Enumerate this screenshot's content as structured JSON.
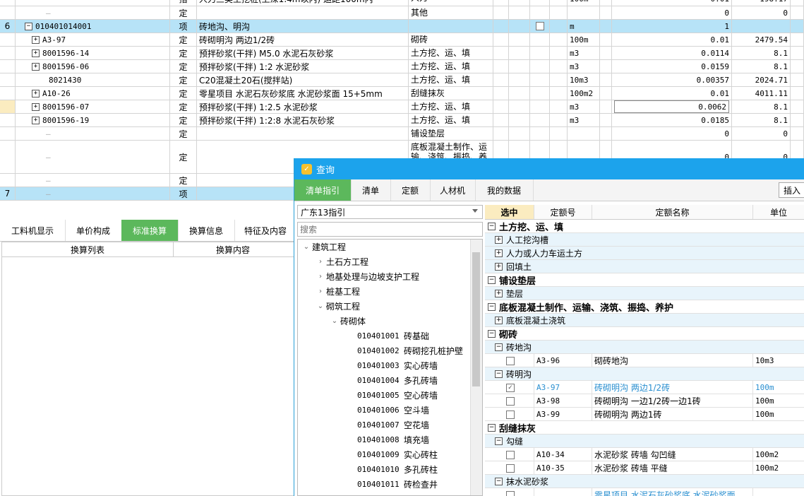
{
  "main_grid": {
    "rows": [
      {
        "idx": "",
        "code": "",
        "type": "指",
        "name": "人力三类土挖桩(上深1.4m以内) 运距100m内",
        "cat": "人力",
        "chk": false,
        "unit": "100m",
        "qty": "0.01",
        "price": "198.17"
      },
      {
        "idx": "",
        "code": "",
        "type": "定",
        "name": "",
        "cat": "其他",
        "chk": false,
        "unit": "",
        "qty": "0",
        "price": "0"
      },
      {
        "idx": "6",
        "code": "010401014001",
        "type": "项",
        "name": "砖地沟、明沟",
        "cat": "",
        "chk": true,
        "unit": "m",
        "qty": "1",
        "price": ""
      },
      {
        "idx": "",
        "code": "A3-97",
        "type": "定",
        "name": "砖砌明沟 两边1/2砖",
        "cat": "砌砖",
        "chk": false,
        "unit": "100m",
        "qty": "0.01",
        "price": "2479.54"
      },
      {
        "idx": "",
        "code": "8001596-14",
        "type": "定",
        "name": "预拌砂浆(干拌) M5.0 水泥石灰砂浆",
        "cat": "土方挖、运、填",
        "chk": false,
        "unit": "m3",
        "qty": "0.0114",
        "price": "8.1"
      },
      {
        "idx": "",
        "code": "8001596-06",
        "type": "定",
        "name": "预拌砂浆(干拌) 1:2 水泥砂浆",
        "cat": "土方挖、运、填",
        "chk": false,
        "unit": "m3",
        "qty": "0.0159",
        "price": "8.1"
      },
      {
        "idx": "",
        "code": "8021430",
        "type": "定",
        "name": "C20混凝土20石(搅拌站)",
        "cat": "土方挖、运、填",
        "chk": false,
        "unit": "10m3",
        "qty": "0.00357",
        "price": "2024.71"
      },
      {
        "idx": "",
        "code": "A10-26",
        "type": "定",
        "name": "零星项目 水泥石灰砂浆底 水泥砂浆面 15+5mm",
        "cat": "刮缝抹灰",
        "chk": false,
        "unit": "100m2",
        "qty": "0.01",
        "price": "4011.11"
      },
      {
        "idx": "",
        "code": "8001596-07",
        "type": "定",
        "name": "预拌砂浆(干拌) 1:2.5 水泥砂浆",
        "cat": "土方挖、运、填",
        "chk": false,
        "unit": "m3",
        "qty": "0.0062",
        "price": "8.1"
      },
      {
        "idx": "",
        "code": "8001596-19",
        "type": "定",
        "name": "预拌砂浆(干拌) 1:2:8 水泥石灰砂浆",
        "cat": "土方挖、运、填",
        "chk": false,
        "unit": "m3",
        "qty": "0.0185",
        "price": "8.1"
      },
      {
        "idx": "",
        "code": "",
        "type": "定",
        "name": "",
        "cat": "铺设垫层",
        "chk": false,
        "unit": "",
        "qty": "0",
        "price": "0"
      },
      {
        "idx": "",
        "code": "",
        "type": "定",
        "name": "",
        "cat": "底板混凝土制作、运输、浇筑、振捣、养",
        "chk": false,
        "unit": "",
        "qty": "0",
        "price": "0"
      },
      {
        "idx": "",
        "code": "",
        "type": "定",
        "name": "",
        "cat": "",
        "chk": false,
        "unit": "",
        "qty": "",
        "price": ""
      },
      {
        "idx": "7",
        "code": "",
        "type": "项",
        "name": "",
        "cat": "",
        "chk": false,
        "unit": "",
        "qty": "",
        "price": ""
      }
    ]
  },
  "bottom_tabs": [
    "工料机显示",
    "单价构成",
    "标准换算",
    "换算信息",
    "特征及内容"
  ],
  "conv_table": {
    "col1": "换算列表",
    "col2": "换算内容"
  },
  "dialog": {
    "title": "查询",
    "tabs": [
      "清单指引",
      "清单",
      "定额",
      "人材机",
      "我的数据"
    ],
    "insert_label": "插入",
    "guide_select": "广东13指引",
    "search_placeholder": "搜索",
    "tree": {
      "root": "建筑工程",
      "children": [
        "土石方工程",
        "地基处理与边坡支护工程",
        "桩基工程",
        "砌筑工程"
      ],
      "sub": "砖砌体",
      "leaves": [
        {
          "code": "010401001",
          "name": "砖基础"
        },
        {
          "code": "010401002",
          "name": "砖砌挖孔桩护壁"
        },
        {
          "code": "010401003",
          "name": "实心砖墙"
        },
        {
          "code": "010401004",
          "name": "多孔砖墙"
        },
        {
          "code": "010401005",
          "name": "空心砖墙"
        },
        {
          "code": "010401006",
          "name": "空斗墙"
        },
        {
          "code": "010401007",
          "name": "空花墙"
        },
        {
          "code": "010401008",
          "name": "填充墙"
        },
        {
          "code": "010401009",
          "name": "实心砖柱"
        },
        {
          "code": "010401010",
          "name": "多孔砖柱"
        },
        {
          "code": "010401011",
          "name": "砖检查井"
        }
      ]
    },
    "quota": {
      "headers": [
        "选中",
        "定额号",
        "定额名称",
        "单位"
      ],
      "rows": [
        {
          "kind": "grp",
          "sign": "−",
          "text": "土方挖、运、填"
        },
        {
          "kind": "sub",
          "sign": "+",
          "text": "人工挖沟槽"
        },
        {
          "kind": "sub",
          "sign": "+",
          "text": "人力或人力车运土方"
        },
        {
          "kind": "sub",
          "sign": "+",
          "text": "回填土"
        },
        {
          "kind": "grp",
          "sign": "−",
          "text": "铺设垫层"
        },
        {
          "kind": "sub",
          "sign": "+",
          "text": "垫层"
        },
        {
          "kind": "grp",
          "sign": "−",
          "text": "底板混凝土制作、运输、浇筑、振捣、养护"
        },
        {
          "kind": "sub",
          "sign": "+",
          "text": "底板混凝土浇筑"
        },
        {
          "kind": "grp",
          "sign": "−",
          "text": "砌砖"
        },
        {
          "kind": "sub",
          "sign": "−",
          "text": "砖地沟"
        },
        {
          "kind": "item",
          "checked": false,
          "code": "A3-96",
          "name": "砌砖地沟",
          "unit": "10m3",
          "hl": false
        },
        {
          "kind": "sub",
          "sign": "−",
          "text": "砖明沟"
        },
        {
          "kind": "item",
          "checked": true,
          "code": "A3-97",
          "name": "砖砌明沟 两边1/2砖",
          "unit": "100m",
          "hl": true
        },
        {
          "kind": "item",
          "checked": false,
          "code": "A3-98",
          "name": "砖砌明沟 一边1/2砖一边1砖",
          "unit": "100m",
          "hl": false
        },
        {
          "kind": "item",
          "checked": false,
          "code": "A3-99",
          "name": "砖砌明沟 两边1砖",
          "unit": "100m",
          "hl": false
        },
        {
          "kind": "grp",
          "sign": "−",
          "text": "刮缝抹灰"
        },
        {
          "kind": "sub",
          "sign": "−",
          "text": "勾缝"
        },
        {
          "kind": "item",
          "checked": false,
          "code": "A10-34",
          "name": "水泥砂浆 砖墙 勾凹缝",
          "unit": "100m2",
          "hl": false
        },
        {
          "kind": "item",
          "checked": false,
          "code": "A10-35",
          "name": "水泥砂浆 砖墙 平缝",
          "unit": "100m2",
          "hl": false
        },
        {
          "kind": "sub",
          "sign": "−",
          "text": "抹水泥砂浆"
        },
        {
          "kind": "item",
          "checked": false,
          "code": "",
          "name": "零星项目 水泥石灰砂浆底 水泥砂浆面",
          "unit": "",
          "hl": true
        }
      ]
    }
  },
  "colors": {
    "selected_row": "#b7e3f7",
    "accent_green": "#5cb85c",
    "dialog_title": "#1ca3ec",
    "highlight_text": "#2a8fd0"
  }
}
